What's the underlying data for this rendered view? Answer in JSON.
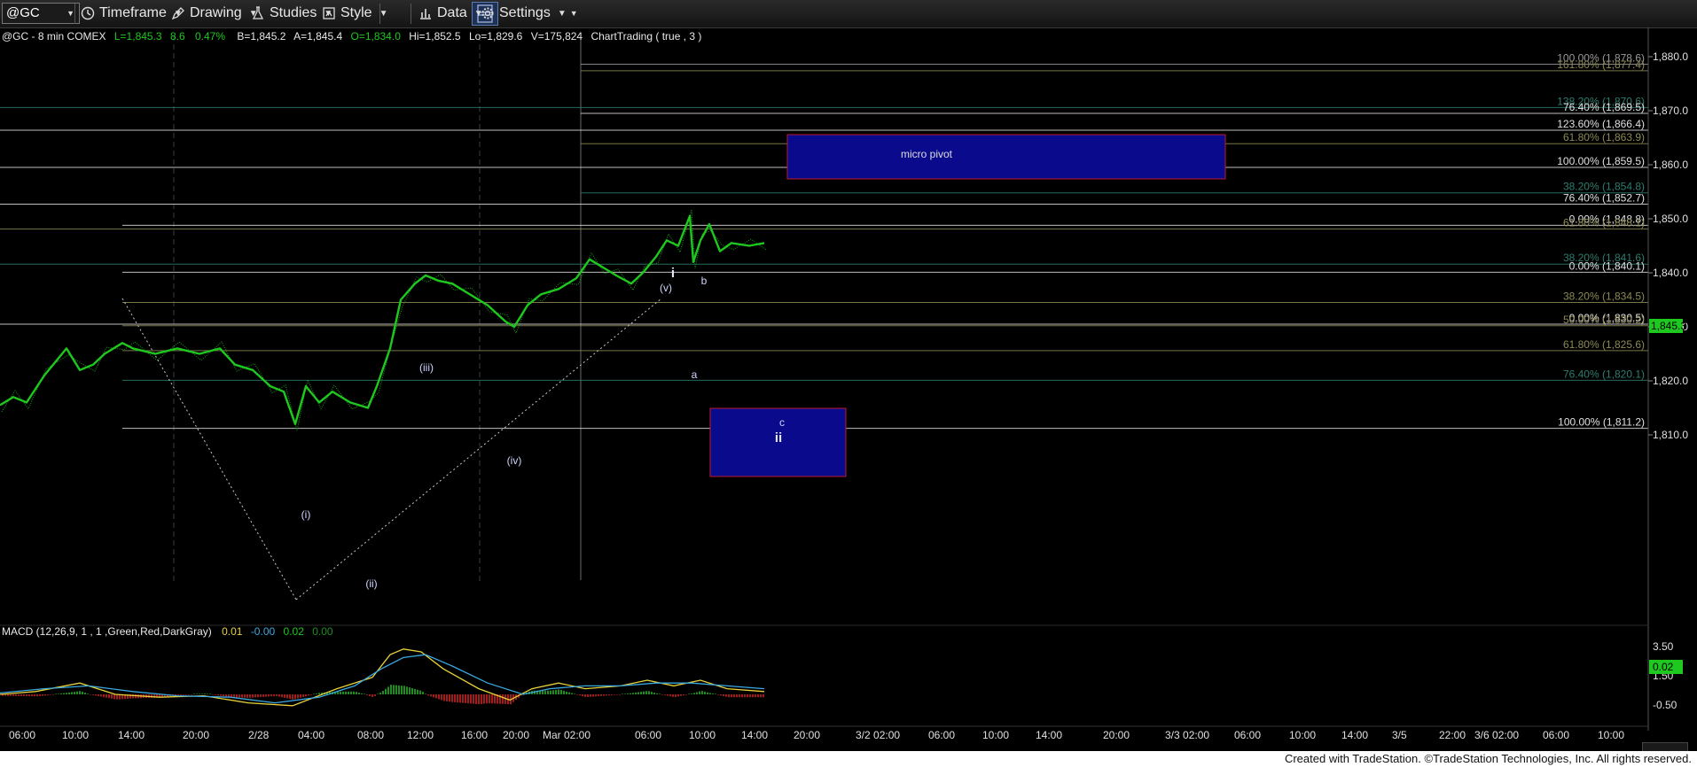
{
  "toolbar": {
    "symbol": "@GC",
    "timeframe_label": "Timeframe",
    "drawing_label": "Drawing",
    "studies_label": "Studies",
    "style_label": "Style",
    "data_label": "Data",
    "settings_label": "Settings"
  },
  "chart_header": {
    "text": "@GC - 8 min  COMEX",
    "last": "L=1,845.3",
    "change": "8.6",
    "change_pct": "0.47%",
    "bid": "B=1,845.2",
    "ask": "A=1,845.4",
    "open": "O=1,834.0",
    "high": "Hi=1,852.5",
    "low": "Lo=1,829.6",
    "volume": "V=175,824",
    "study": "ChartTrading ( true , 3 )"
  },
  "price_axis": {
    "labels": [
      "1,880.0",
      "1,870.0",
      "1,860.0",
      "1,850.0",
      "1,840.0",
      "1,830.0",
      "1,820.0",
      "1,810.0"
    ],
    "last_price_tag": "1,845.3",
    "last_price_color": "#1ec81e"
  },
  "macd": {
    "label": "MACD (12,26,9, 1 , 1 ,Green,Red,DarkGray)",
    "v1": "0.01",
    "v2": "-0.00",
    "v3": "0.02",
    "v4": "0.00",
    "axis_labels": [
      "3.50",
      "1.50",
      "-0.50"
    ],
    "value_tag": "0.02"
  },
  "time_axis": {
    "labels": [
      "06:00",
      "10:00",
      "14:00",
      "20:00",
      "2/28",
      "04:00",
      "08:00",
      "12:00",
      "16:00",
      "20:00",
      "Mar 02:00",
      "06:00",
      "10:00",
      "14:00",
      "20:00",
      "3/2 02:00",
      "06:00",
      "10:00",
      "14:00",
      "20:00",
      "3/3 02:00",
      "06:00",
      "10:00",
      "14:00",
      "3/5",
      "22:00",
      "3/6 02:00",
      "06:00",
      "10:00"
    ]
  },
  "fib_labels": [
    {
      "text": "100.00% (1,878.6)",
      "color": "#9a9a9a"
    },
    {
      "text": "161.80% (1,877.4)",
      "color": "#8d8a55"
    },
    {
      "text": "138.20% (1,870.6)",
      "color": "#2e7d6e"
    },
    {
      "text": "76.40% (1,869.5)",
      "color": "#e0e0e0"
    },
    {
      "text": "123.60% (1,866.4)",
      "color": "#e0e0e0"
    },
    {
      "text": "61.80% (1,863.9)",
      "color": "#8d8a55"
    },
    {
      "text": "100.00% (1,859.5)",
      "color": "#e0e0e0"
    },
    {
      "text": "38.20% (1,854.8)",
      "color": "#2e7d6e"
    },
    {
      "text": "76.40% (1,852.7)",
      "color": "#e0e0e0"
    },
    {
      "text": "0.00% (1,848.8)",
      "color": "#e0e0e0"
    },
    {
      "text": "61.80% (1,848.1)",
      "color": "#8d8a55"
    },
    {
      "text": "38.20% (1,841.6)",
      "color": "#2e7d6e"
    },
    {
      "text": "0.00% (1,840.1)",
      "color": "#e0e0e0"
    },
    {
      "text": "38.20% (1,834.5)",
      "color": "#8d8a55"
    },
    {
      "text": "0.00% (1,830.5)",
      "color": "#e0e0e0"
    },
    {
      "text": "50.00% (1,830.2)",
      "color": "#8d8a55"
    },
    {
      "text": "61.80% (1,825.6)",
      "color": "#8d8a55"
    },
    {
      "text": "76.40% (1,820.1)",
      "color": "#2e7d6e"
    },
    {
      "text": "100.00% (1,811.2)",
      "color": "#e0e0e0"
    }
  ],
  "annotations": {
    "micro_pivot": "micro pivot",
    "wave_i": "(i)",
    "wave_ii": "(ii)",
    "wave_iii": "(iii)",
    "wave_iv": "(iv)",
    "wave_v": "(v)",
    "wave_1": "i",
    "wave_a": "a",
    "wave_b": "b",
    "wave_c": "c",
    "wave_2": "ii"
  },
  "footer": {
    "text": "Created with TradeStation. ©TradeStation Technologies, Inc. All rights reserved."
  },
  "colors": {
    "background": "#000000",
    "price_bars": "#1ec81e",
    "box_fill": "#0a0a8c",
    "box_border": "#c0192c",
    "macd_line": "#e8d23a",
    "signal_line": "#3aa8e0"
  }
}
